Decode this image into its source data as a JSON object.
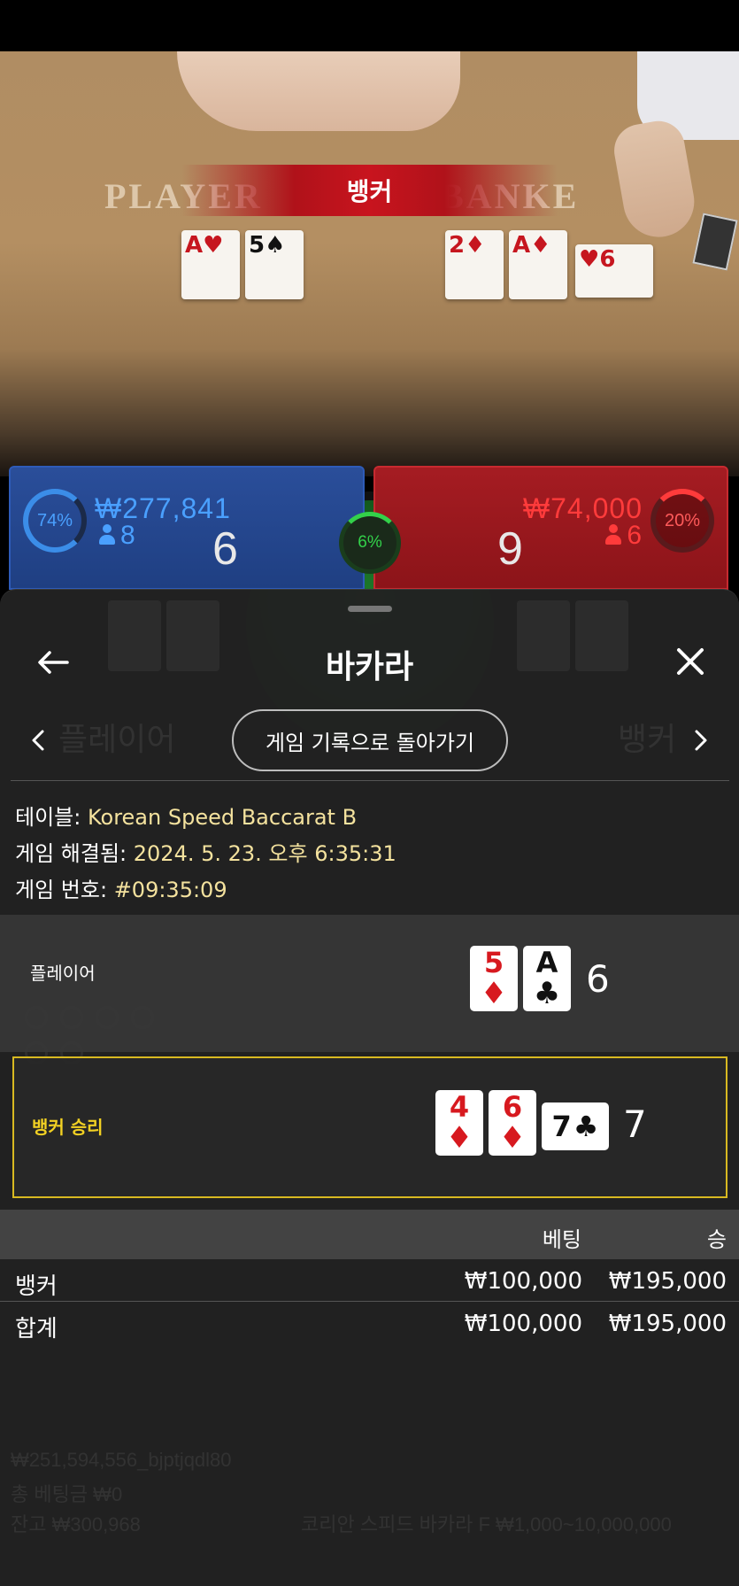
{
  "video": {
    "table_print_player": "PLAYER",
    "table_print_banker": "BANKE",
    "winner_banner": "뱅커",
    "player_cards": [
      {
        "rank": "A",
        "suit": "♥",
        "color": "red"
      },
      {
        "rank": "5",
        "suit": "♠",
        "color": "black"
      }
    ],
    "banker_cards": [
      {
        "rank": "2",
        "suit": "♦",
        "color": "red"
      },
      {
        "rank": "A",
        "suit": "♦",
        "color": "red"
      },
      {
        "rank": "6",
        "suit": "♥",
        "color": "red"
      }
    ]
  },
  "scoreboard": {
    "player": {
      "percent": "74%",
      "amount": "₩277,841",
      "players": "8",
      "score": "6",
      "color": "#2e5bb8"
    },
    "tie": {
      "percent": "6%"
    },
    "banker": {
      "percent": "20%",
      "amount": "₩74,000",
      "players": "6",
      "score": "9",
      "color": "#c72a30"
    }
  },
  "sheet": {
    "title": "바카라",
    "back_icon": "arrow-left-icon",
    "close_icon": "close-icon",
    "back_to_history": "게임 기록으로 돌아가기",
    "info": {
      "table_label": "테이블:",
      "table_value": "Korean Speed Baccarat B",
      "resolved_label": "게임 해결됨:",
      "resolved_value": "2024. 5. 23. 오후 6:35:31",
      "game_no_label": "게임 번호:",
      "game_no_value": "#09:35:09"
    },
    "player_hand": {
      "label": "플레이어",
      "cards": [
        {
          "rank": "5",
          "suit": "♦",
          "color": "red"
        },
        {
          "rank": "A",
          "suit": "♣",
          "color": "black"
        }
      ],
      "total": "6"
    },
    "banker_hand": {
      "label": "뱅커 승리",
      "cards": [
        {
          "rank": "4",
          "suit": "♦",
          "color": "red"
        },
        {
          "rank": "6",
          "suit": "♦",
          "color": "red"
        },
        {
          "rank": "7",
          "suit": "♣",
          "color": "black",
          "sideways": true
        }
      ],
      "total": "7",
      "highlight_color": "#d8b921"
    },
    "bets": {
      "header_bet": "베팅",
      "header_win": "승",
      "rows": [
        {
          "label": "뱅커",
          "bet": "₩100,000",
          "win": "₩195,000"
        },
        {
          "label": "합계",
          "bet": "₩100,000",
          "win": "₩195,000"
        }
      ]
    }
  },
  "background_ghost": {
    "player_label": "플레이어",
    "banker_label": "뱅커",
    "footer_line1": "₩251,594,556_bjptjqdl80",
    "footer_line2": "총 베팅금 ₩0",
    "footer_line3": "잔고 ₩300,968",
    "footer_table": "코리안 스피드 바카라 F  ₩1,000~10,000,000"
  }
}
